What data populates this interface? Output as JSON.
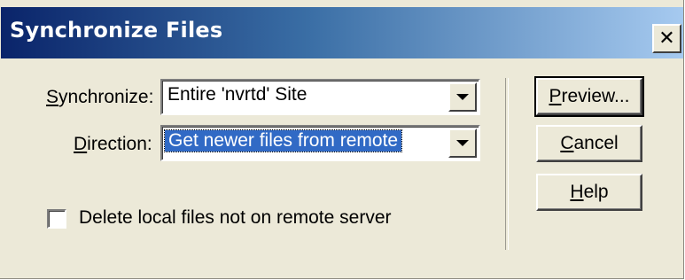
{
  "window": {
    "title": "Synchronize Files",
    "close_glyph": "✕"
  },
  "synchronize": {
    "label_prefix": "",
    "label_accel": "S",
    "label_rest": "ynchronize:",
    "value": "Entire 'nvrtd' Site"
  },
  "direction": {
    "label_accel": "D",
    "label_rest": "irection:",
    "value": "Get newer files from remote"
  },
  "checkbox": {
    "label": "Delete local files not on remote server",
    "checked": false
  },
  "buttons": {
    "preview": {
      "accel": "P",
      "rest": "review..."
    },
    "cancel": {
      "accel": "C",
      "rest": "ancel"
    },
    "help": {
      "accel": "H",
      "rest": "elp"
    }
  },
  "colors": {
    "title_start": "#0a246a",
    "title_end": "#a6caf0",
    "dialog_bg": "#ece9d8",
    "selection": "#316ac5"
  }
}
